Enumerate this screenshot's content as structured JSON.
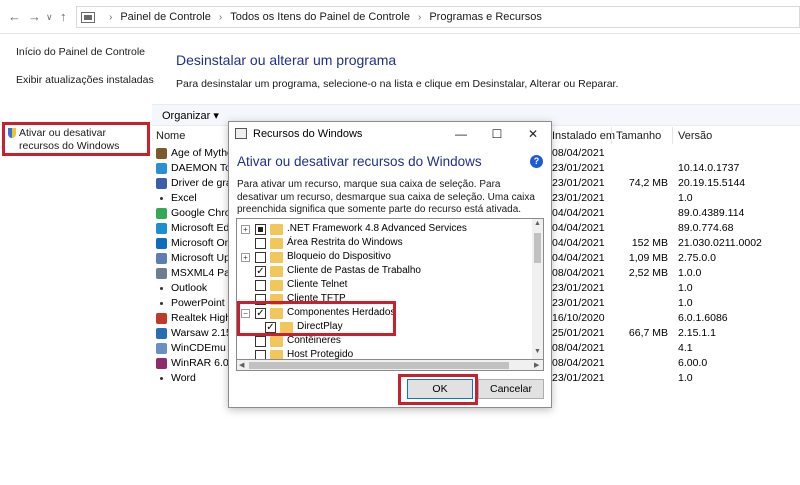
{
  "address_bar": {
    "crumbs": [
      "Painel de Controle",
      "Todos os Itens do Painel de Controle",
      "Programas e Recursos"
    ]
  },
  "left_pane": {
    "home_link": "Início do Painel de Controle",
    "updates_link": "Exibir atualizações instaladas",
    "features_link": "Ativar ou desativar recursos do Windows"
  },
  "main": {
    "title": "Desinstalar ou alterar um programa",
    "description": "Para desinstalar um programa, selecione-o na lista e clique em Desinstalar, Alterar ou Reparar.",
    "organize_label": "Organizar ▾",
    "columns": {
      "name": "Nome",
      "installed": "Instalado em",
      "size": "Tamanho",
      "version": "Versão"
    },
    "programs": [
      {
        "name": "Age of Mytholo",
        "installed": "08/04/2021",
        "size": "",
        "version": "",
        "icon_color": "#7a5a2a"
      },
      {
        "name": "DAEMON Tools",
        "installed": "23/01/2021",
        "size": "",
        "version": "10.14.0.1737",
        "icon_color": "#2c8fd6"
      },
      {
        "name": "Driver de gráfi",
        "installed": "23/01/2021",
        "size": "74,2 MB",
        "version": "20.19.15.5144",
        "icon_color": "#3a5fa8"
      },
      {
        "name": "Excel",
        "installed": "23/01/2021",
        "size": "",
        "version": "1.0",
        "icon_color": ""
      },
      {
        "name": "Google Chrom",
        "installed": "04/04/2021",
        "size": "",
        "version": "89.0.4389.114",
        "icon_color": "#34a853"
      },
      {
        "name": "Microsoft Edg",
        "installed": "04/04/2021",
        "size": "",
        "version": "89.0.774.68",
        "icon_color": "#1a8fd1"
      },
      {
        "name": "Microsoft One",
        "installed": "04/04/2021",
        "size": "152 MB",
        "version": "21.030.0211.0002",
        "icon_color": "#0f6cbd"
      },
      {
        "name": "Microsoft Upd",
        "installed": "04/04/2021",
        "size": "1,09 MB",
        "version": "2.75.0.0",
        "icon_color": "#5a7fb0"
      },
      {
        "name": "MSXML4 Parse",
        "installed": "08/04/2021",
        "size": "2,52 MB",
        "version": "1.0.0",
        "icon_color": "#6b7c93"
      },
      {
        "name": "Outlook",
        "installed": "23/01/2021",
        "size": "",
        "version": "1.0",
        "icon_color": ""
      },
      {
        "name": "PowerPoint",
        "installed": "23/01/2021",
        "size": "",
        "version": "1.0",
        "icon_color": ""
      },
      {
        "name": "Realtek High D",
        "installed": "16/10/2020",
        "size": "",
        "version": "6.0.1.6086",
        "icon_color": "#c0392b"
      },
      {
        "name": "Warsaw 2.15.1",
        "installed": "25/01/2021",
        "size": "66,7 MB",
        "version": "2.15.1.1",
        "icon_color": "#2a6db5"
      },
      {
        "name": "WinCDEmu",
        "installed": "08/04/2021",
        "size": "",
        "version": "4.1",
        "icon_color": "#6a8fc4"
      },
      {
        "name": "WinRAR 6.00 (",
        "installed": "08/04/2021",
        "size": "",
        "version": "6.00.0",
        "icon_color": "#8e2a6d"
      },
      {
        "name": "Word",
        "installed": "23/01/2021",
        "size": "",
        "version": "1.0",
        "icon_color": ""
      }
    ]
  },
  "dialog": {
    "window_title": "Recursos do Windows",
    "heading": "Ativar ou desativar recursos do Windows",
    "description": "Para ativar um recurso, marque sua caixa de seleção. Para desativar um recurso, desmarque sua caixa de seleção. Uma caixa preenchida significa que somente parte do recurso está ativada.",
    "features": [
      {
        "label": ".NET Framework 4.8 Advanced Services",
        "state": "partial",
        "expandable": true,
        "indent": 0
      },
      {
        "label": "Área Restrita do Windows",
        "state": "unchecked",
        "expandable": false,
        "indent": 0
      },
      {
        "label": "Bloqueio do Dispositivo",
        "state": "unchecked",
        "expandable": true,
        "indent": 0
      },
      {
        "label": "Cliente de Pastas de Trabalho",
        "state": "checked",
        "expandable": false,
        "indent": 0
      },
      {
        "label": "Cliente Telnet",
        "state": "unchecked",
        "expandable": false,
        "indent": 0
      },
      {
        "label": "Cliente TFTP",
        "state": "unchecked",
        "expandable": false,
        "indent": 0
      },
      {
        "label": "Componentes Herdados",
        "state": "checked",
        "expandable": true,
        "expanded": true,
        "indent": 0
      },
      {
        "label": "DirectPlay",
        "state": "checked",
        "expandable": false,
        "indent": 1
      },
      {
        "label": "Contêineres",
        "state": "unchecked",
        "expandable": false,
        "indent": 0
      },
      {
        "label": "Host Protegido",
        "state": "unchecked",
        "expandable": false,
        "indent": 0
      }
    ],
    "ok_label": "OK",
    "cancel_label": "Cancelar",
    "help_glyph": "?"
  },
  "colors": {
    "title_blue": "#1e3287",
    "highlight_red": "#c9202e",
    "folder_yellow": "#f1c75b"
  }
}
